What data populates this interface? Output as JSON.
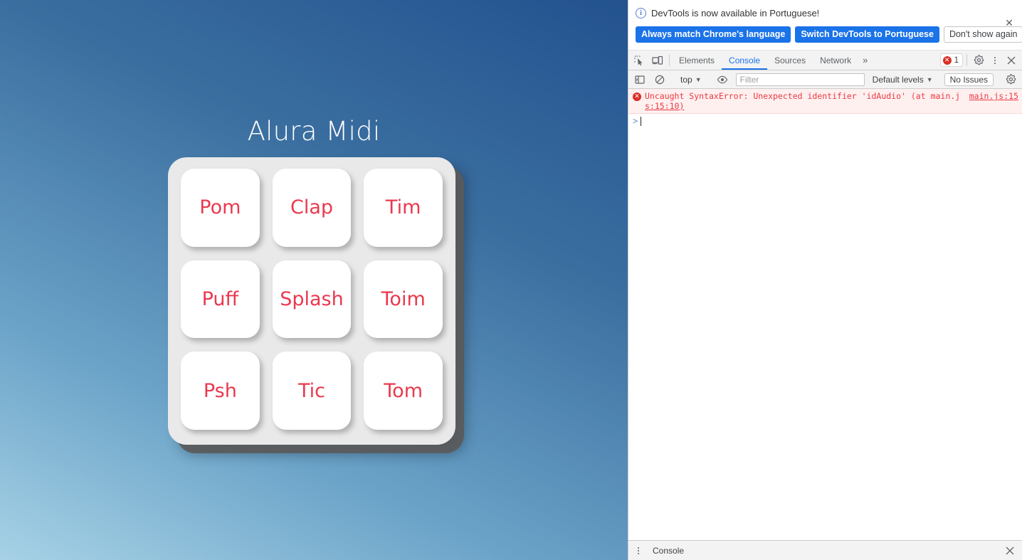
{
  "page": {
    "title": "Alura Midi",
    "accent_red": "#ea394e",
    "keys": [
      {
        "label": "Pom"
      },
      {
        "label": "Clap"
      },
      {
        "label": "Tim"
      },
      {
        "label": "Puff"
      },
      {
        "label": "Splash"
      },
      {
        "label": "Toim"
      },
      {
        "label": "Psh"
      },
      {
        "label": "Tic"
      },
      {
        "label": "Tom"
      }
    ]
  },
  "devtools": {
    "banner": {
      "icon": "info-icon",
      "message": "DevTools is now available in Portuguese!",
      "primary_button_1": "Always match Chrome's language",
      "primary_button_2": "Switch DevTools to Portuguese",
      "secondary_button": "Don't show again",
      "close_icon": "✕",
      "button_color": "#1a73e8"
    },
    "tabs": [
      {
        "label": "Elements",
        "active": false
      },
      {
        "label": "Console",
        "active": true
      },
      {
        "label": "Sources",
        "active": false
      },
      {
        "label": "Network",
        "active": false
      }
    ],
    "more_tabs_icon": "»",
    "error_badge": {
      "icon": "error-circle-icon",
      "count": "1"
    },
    "console_toolbar": {
      "context": "top",
      "filter_placeholder": "Filter",
      "filter_value": "",
      "levels": "Default levels",
      "issues": "No Issues",
      "caret": "▼"
    },
    "console": {
      "messages": [
        {
          "type": "error",
          "text": "Uncaught SyntaxError: Unexpected identifier 'idAudio' (at main.j",
          "text_wrap": "s:15:10)",
          "link_text": "main.j",
          "link_wrap": "s:15:10",
          "source": "main.js:15"
        }
      ],
      "prompt_symbol": ">"
    },
    "drawer": {
      "tab_label": "Console",
      "close_icon": "✕"
    }
  }
}
